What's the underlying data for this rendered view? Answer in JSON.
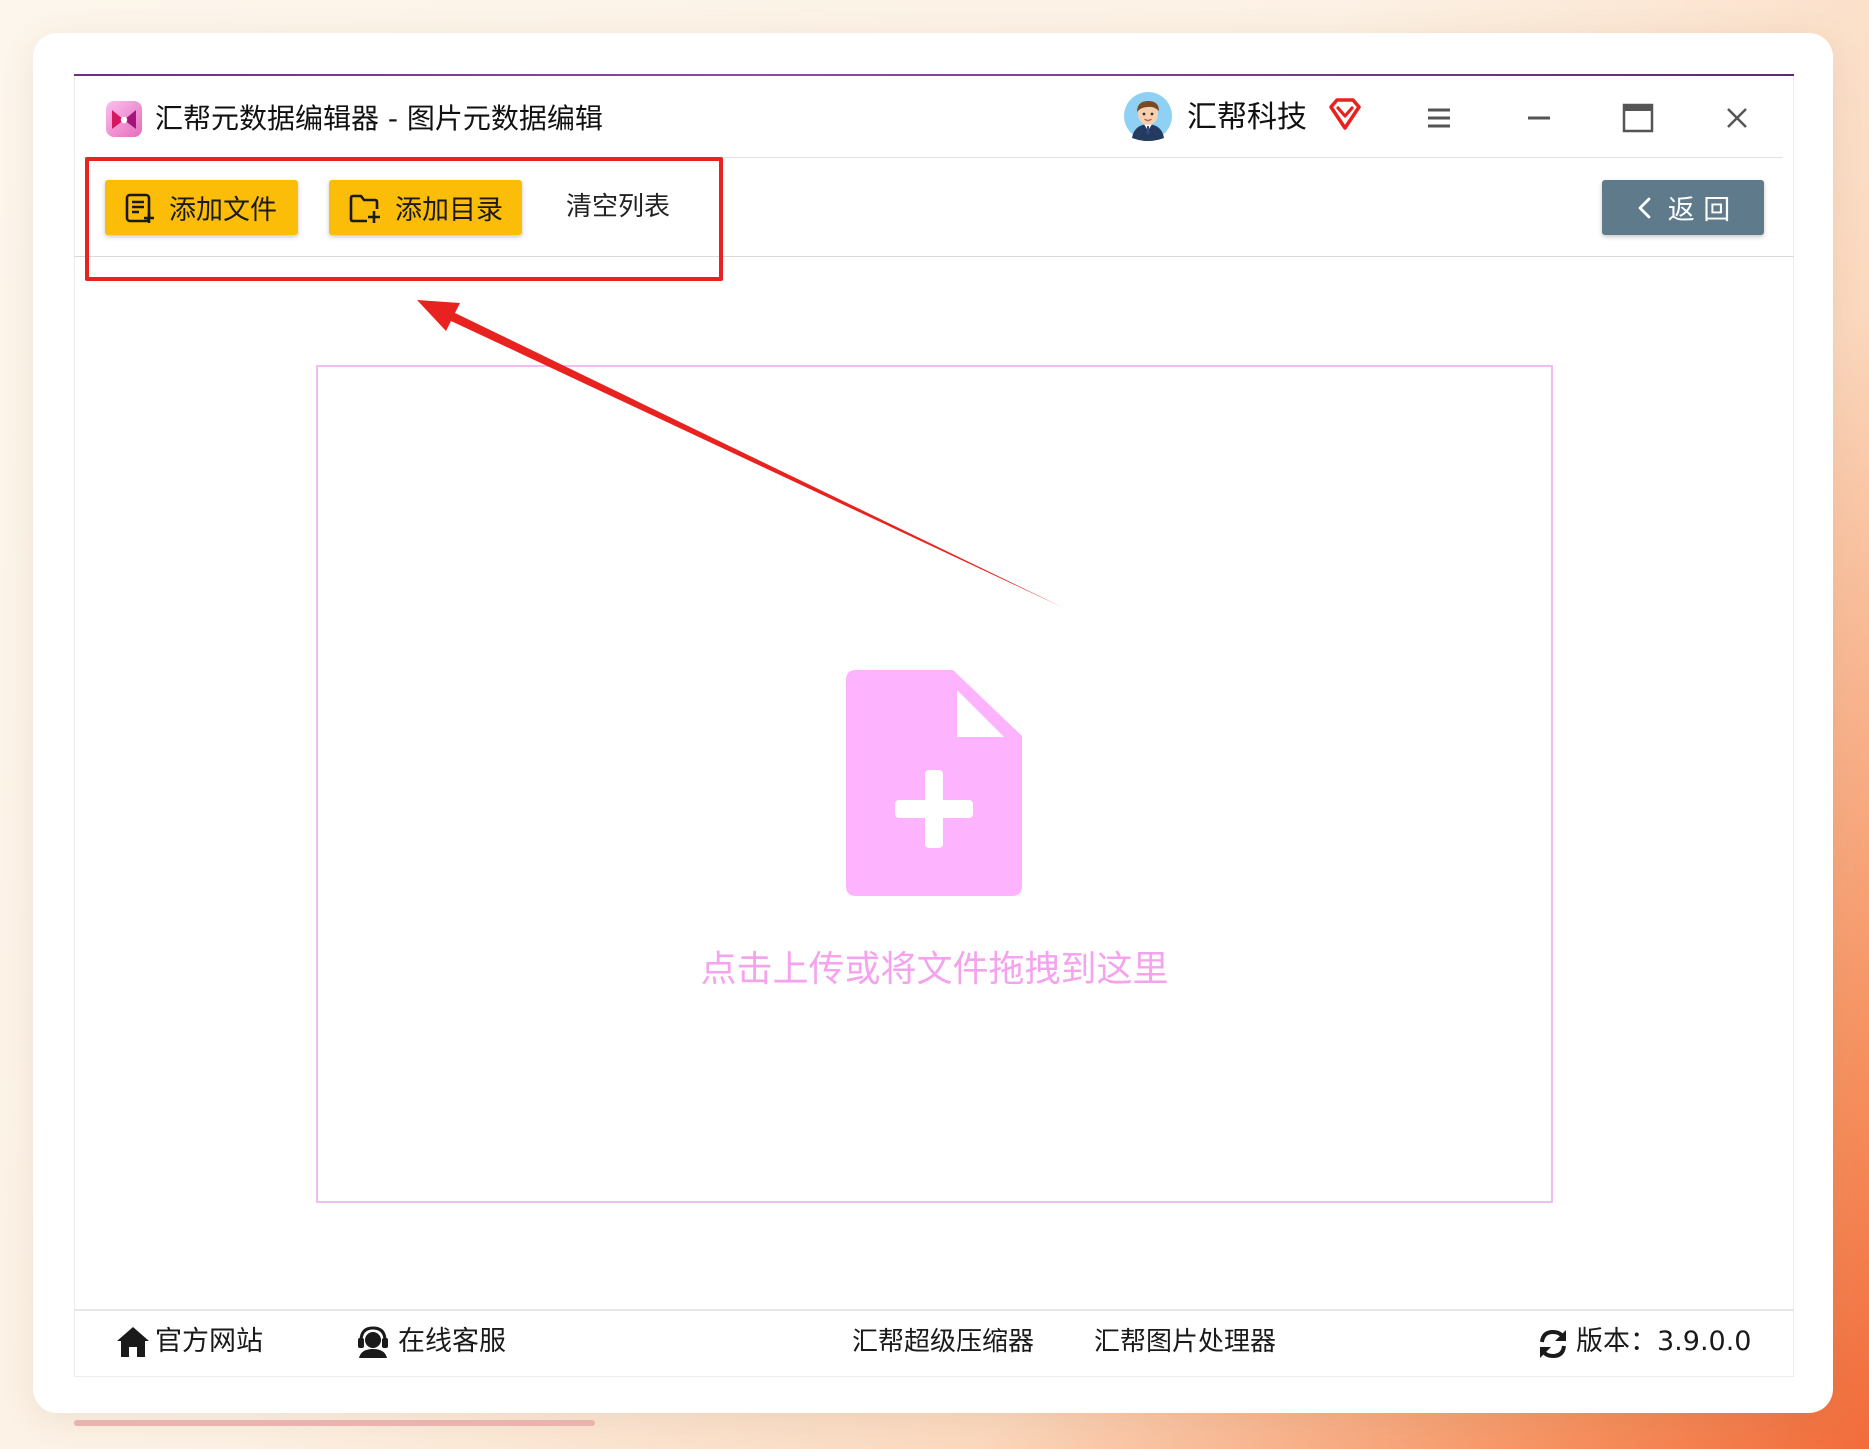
{
  "window": {
    "title": "汇帮元数据编辑器 - 图片元数据编辑",
    "user_name": "汇帮科技"
  },
  "toolbar": {
    "add_file_label": "添加文件",
    "add_folder_label": "添加目录",
    "clear_list_label": "清空列表",
    "back_label": "返 回"
  },
  "dropzone": {
    "prompt": "点击上传或将文件拖拽到这里"
  },
  "footer": {
    "website_label": "官方网站",
    "support_label": "在线客服",
    "compressor_link": "汇帮超级压缩器",
    "image_processor_link": "汇帮图片处理器",
    "version_label": "版本：3.9.0.0"
  },
  "icons": {
    "app_logo": "app-logo-icon",
    "avatar": "user-avatar",
    "vip": "vip-diamond-icon",
    "menu": "menu-icon",
    "minimize": "minimize-icon",
    "maximize": "maximize-icon",
    "close": "close-icon",
    "add_file": "add-file-icon",
    "add_folder": "add-folder-icon",
    "back": "chevron-left-icon",
    "upload": "file-plus-icon",
    "website": "home-icon",
    "support": "headset-icon",
    "version": "refresh-icon"
  },
  "colors": {
    "primary_button": "#fbbd08",
    "back_button": "#5f7a8b",
    "dropzone_border": "#f0bdf0",
    "dropzone_icon": "#fdb3fd",
    "dropzone_text": "#f5a3ee",
    "annotation": "#e8231f"
  }
}
